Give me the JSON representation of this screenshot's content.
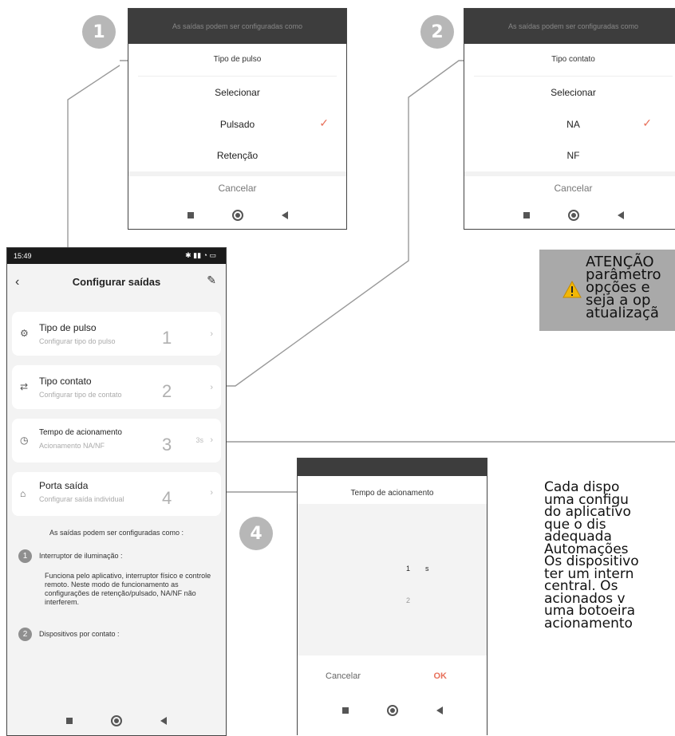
{
  "badges": [
    "1",
    "2",
    "4"
  ],
  "dialog1": {
    "header": "As saídas podem ser configuradas como",
    "title": "Tipo de pulso",
    "options": [
      "Selecionar",
      "Pulsado",
      "Retenção"
    ],
    "cancel": "Cancelar"
  },
  "dialog2": {
    "header": "As saídas podem ser configuradas como",
    "title": "Tipo contato",
    "options": [
      "Selecionar",
      "NA",
      "NF"
    ],
    "cancel": "Cancelar"
  },
  "phone": {
    "time": "15:49",
    "title": "Configurar saídas",
    "items": [
      {
        "title": "Tipo de pulso",
        "subtitle": "Configurar tipo do pulso",
        "number": "1",
        "value": ""
      },
      {
        "title": "Tipo contato",
        "subtitle": "Configurar tipo de contato",
        "number": "2",
        "value": ""
      },
      {
        "title": "Tempo de acionamento",
        "subtitle": "Acionamento NA/NF",
        "number": "3",
        "value": "3s"
      },
      {
        "title": "Porta saída",
        "subtitle": "Configurar saída individual",
        "number": "4",
        "value": ""
      }
    ],
    "notes_title": "As saídas podem ser configuradas como :",
    "note1_title": "Interruptor de iluminação :",
    "note1_body": "Funciona pelo aplicativo, interruptor físico e controle remoto. Neste modo de funcionamento as configurações de retenção/pulsado, NA/NF não interferem.",
    "note2_title": "Dispositivos por contato :"
  },
  "dialog4": {
    "title": "Tempo de acionamento",
    "picker_selected": "1",
    "picker_unit": "s",
    "picker_next": "2",
    "cancel": "Cancelar",
    "ok": "OK"
  },
  "warning": {
    "text": "ATENÇÃO\nparâmetro\nopções e\nseja a op\natualizaçã"
  },
  "paragraph": {
    "text": "Cada dispo\numa configu\ndo aplicativo\nque o dis\nadequada\nAutomações\nOs dispositivo\nter um intern\ncentral. Os\nacionados v\numa botoeira\nacionamento"
  },
  "colors": {
    "accent": "#e8705a",
    "badge": "#b7b7b7",
    "warning_bg": "#a9a9a9",
    "warning_icon": "#f2b705"
  }
}
